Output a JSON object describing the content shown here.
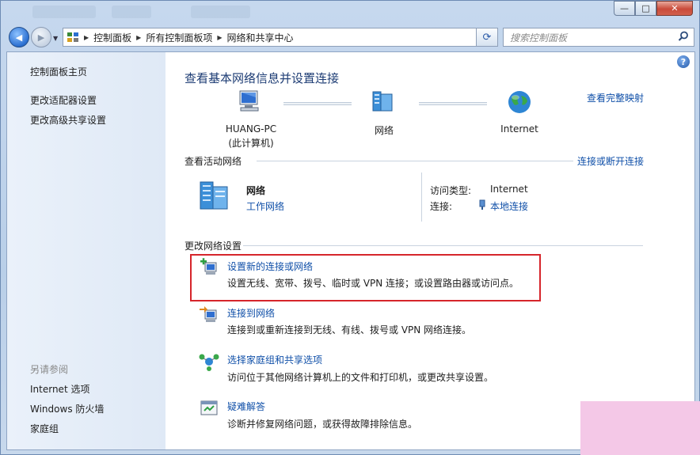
{
  "address": {
    "segments": [
      "控制面板",
      "所有控制面板项",
      "网络和共享中心"
    ]
  },
  "search": {
    "placeholder": "搜索控制面板"
  },
  "sidebar": {
    "home": "控制面板主页",
    "links": [
      "更改适配器设置",
      "更改高级共享设置"
    ],
    "see_also_heading": "另请参阅",
    "see_also": [
      "Internet 选项",
      "Windows 防火墙",
      "家庭组"
    ]
  },
  "main": {
    "title": "查看基本网络信息并设置连接",
    "full_map_link": "查看完整映射",
    "map": {
      "computer_name": "HUANG-PC",
      "computer_note": "(此计算机)",
      "network": "网络",
      "internet": "Internet"
    },
    "active": {
      "heading": "查看活动网络",
      "connect_link": "连接或断开连接",
      "network_name": "网络",
      "network_type": "工作网络",
      "access_label": "访问类型:",
      "access_value": "Internet",
      "connection_label": "连接:",
      "connection_value": "本地连接"
    },
    "change": {
      "heading": "更改网络设置",
      "tasks": [
        {
          "title": "设置新的连接或网络",
          "desc": "设置无线、宽带、拨号、临时或 VPN 连接；或设置路由器或访问点。"
        },
        {
          "title": "连接到网络",
          "desc": "连接到或重新连接到无线、有线、拨号或 VPN 网络连接。"
        },
        {
          "title": "选择家庭组和共享选项",
          "desc": "访问位于其他网络计算机上的文件和打印机，或更改共享设置。"
        },
        {
          "title": "疑难解答",
          "desc": "诊断并修复网络问题，或获得故障排除信息。"
        }
      ]
    }
  },
  "colors": {
    "link": "#0f4fa8",
    "title": "#1d3c74",
    "highlight_box": "#d6252b"
  },
  "icons": {
    "help": "?",
    "close": "✕",
    "maximize": "□",
    "minimize": "—",
    "back": "◀",
    "forward": "▶",
    "refresh": "⟳",
    "search": "⌕"
  }
}
